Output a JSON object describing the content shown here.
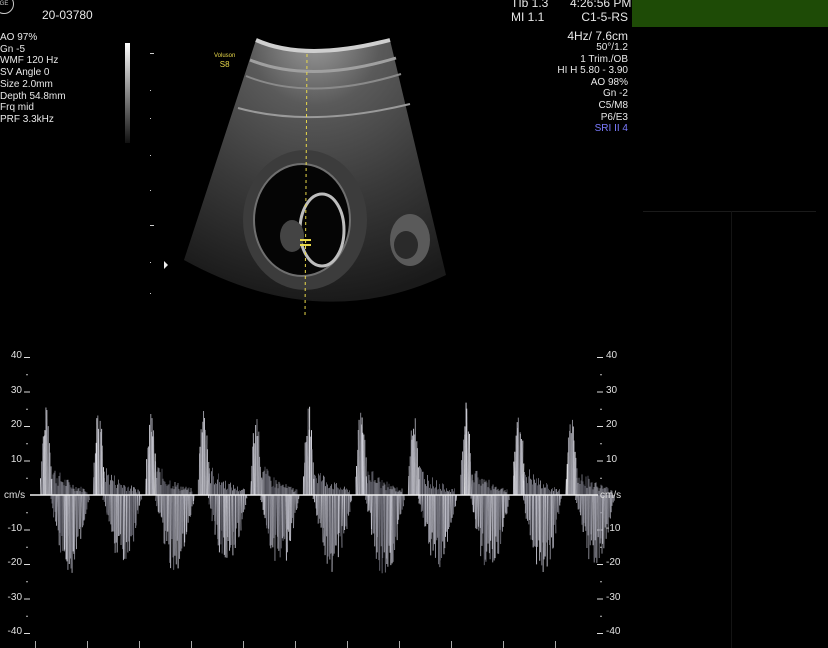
{
  "header": {
    "logo_text": "GE",
    "patient_id": "20-03780",
    "tib": "TIb 1.3",
    "mi": "MI  1.1",
    "time": "4:26:56 PM",
    "probe": "C1-5-RS",
    "freq_depth": "4Hz/ 7.6cm"
  },
  "left_params": [
    "AO 97%",
    "Gn  -5",
    "WMF 120 Hz",
    "SV Angle  0",
    "Size  2.0mm",
    "Depth 54.8mm",
    "Frq mid",
    "PRF  3.3kHz"
  ],
  "right_params": [
    "50°/1.2",
    "1 Trim./OB",
    "HI H  5.80 - 3.90",
    "AO 98%",
    "Gn  -2",
    "C5/M8",
    "P6/E3"
  ],
  "right_highlight": "SRI II 4",
  "watermark": {
    "brand": "Voluson",
    "model": "S8"
  },
  "doppler": {
    "unit": "cm/s",
    "left_ticks": [
      "40",
      "30",
      "20",
      "10",
      "-10",
      "-20",
      "-30",
      "-40"
    ],
    "right_ticks": [
      "40",
      "30",
      "20",
      "10",
      "-10",
      "-20",
      "-30",
      "-40"
    ],
    "peak_velocity_cm_s": 27,
    "min_velocity_cm_s": -26,
    "cycles": 11
  },
  "colors": {
    "accent_green": "#1e4b06",
    "sri_color": "#7b7bff",
    "cursor_yellow": "#e8d84a"
  }
}
